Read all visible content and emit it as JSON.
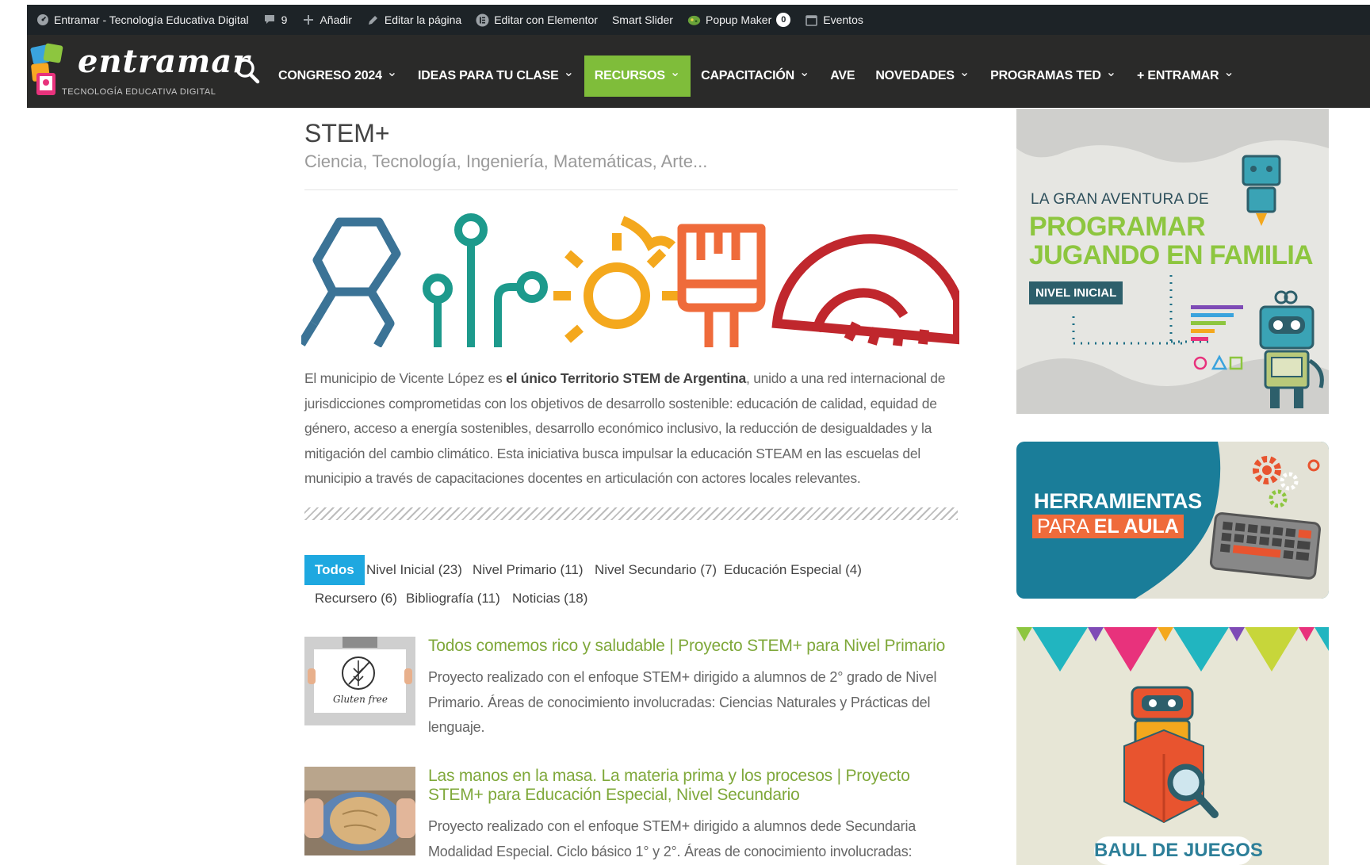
{
  "admin_bar": {
    "site_name": "Entramar - Tecnología Educativa Digital",
    "comments_count": "9",
    "add_label": "Añadir",
    "edit_page_label": "Editar la página",
    "elementor_label": "Editar con Elementor",
    "smart_slider_label": "Smart Slider",
    "popup_maker_label": "Popup Maker",
    "popup_count": "0",
    "events_label": "Eventos"
  },
  "header": {
    "logo_word": "entramar",
    "logo_tagline": "TECNOLOGÍA EDUCATIVA DIGITAL",
    "nav": [
      {
        "label": "CONGRESO 2024",
        "dropdown": true
      },
      {
        "label": "IDEAS PARA TU CLASE",
        "dropdown": true
      },
      {
        "label": "RECURSOS",
        "dropdown": true,
        "active": true
      },
      {
        "label": "CAPACITACIÓN",
        "dropdown": true
      },
      {
        "label": "AVE",
        "dropdown": false
      },
      {
        "label": "NOVEDADES",
        "dropdown": true
      },
      {
        "label": "PROGRAMAS TED",
        "dropdown": true
      },
      {
        "label": "+ ENTRAMAR",
        "dropdown": true
      }
    ],
    "active_color": "#7fbd3a"
  },
  "page": {
    "title": "STEM+",
    "subtitle": "Ciencia, Tecnología, Ingeniería, Matemáticas, Arte...",
    "intro_before": "El municipio de Vicente López es ",
    "intro_bold": "el único Territorio STEM de Argentina",
    "intro_after": ", unido a una red internacional de jurisdicciones comprometidas con los objetivos de desarrollo sostenible: educación de calidad, equidad de género, acceso a energía sostenibles, desarrollo económico inclusivo, la reducción de desigualdades y la mitigación del cambio climático. Esta iniciativa busca impulsar la educación STEAM en las escuelas del municipio a través de capacitaciones docentes en articulación con actores locales relevantes."
  },
  "filters": [
    {
      "label": "Todos",
      "active": true
    },
    {
      "label": "Nivel Inicial (23)"
    },
    {
      "label": "Nivel Primario (11)"
    },
    {
      "label": "Nivel Secundario (7)"
    },
    {
      "label": "Educación Especial (4)"
    },
    {
      "label": "Recursero (6)"
    },
    {
      "label": "Bibliografía (11)"
    },
    {
      "label": "Noticias (18)"
    }
  ],
  "posts": [
    {
      "title": "Todos comemos rico y saludable | Proyecto STEM+ para Nivel Primario",
      "excerpt": "Proyecto realizado con el enfoque STEM+ dirigido a alumnos de 2° grado de Nivel Primario. Áreas de conocimiento involucradas: Ciencias Naturales y Prácticas del lenguaje.",
      "thumb_text": "Gluten free"
    },
    {
      "title": "Las manos en la masa. La materia prima y los procesos | Proyecto STEM+ para Educación Especial, Nivel Secundario",
      "excerpt": "Proyecto realizado con el enfoque STEM+ dirigido a alumnos dede Secundaria Modalidad Especial. Ciclo básico 1° y 2°.  Áreas de conocimiento involucradas:"
    }
  ],
  "sidebar": {
    "banner1": {
      "line1": "LA GRAN AVENTURA DE",
      "line2": "PROGRAMAR",
      "line3": "JUGANDO EN FAMILIA",
      "badge": "NIVEL INICIAL"
    },
    "banner2": {
      "line1": "HERRAMIENTAS",
      "line2a": "PARA ",
      "line2b": "EL AULA"
    },
    "banner3": {
      "label": "BAUL DE JUEGOS"
    }
  }
}
